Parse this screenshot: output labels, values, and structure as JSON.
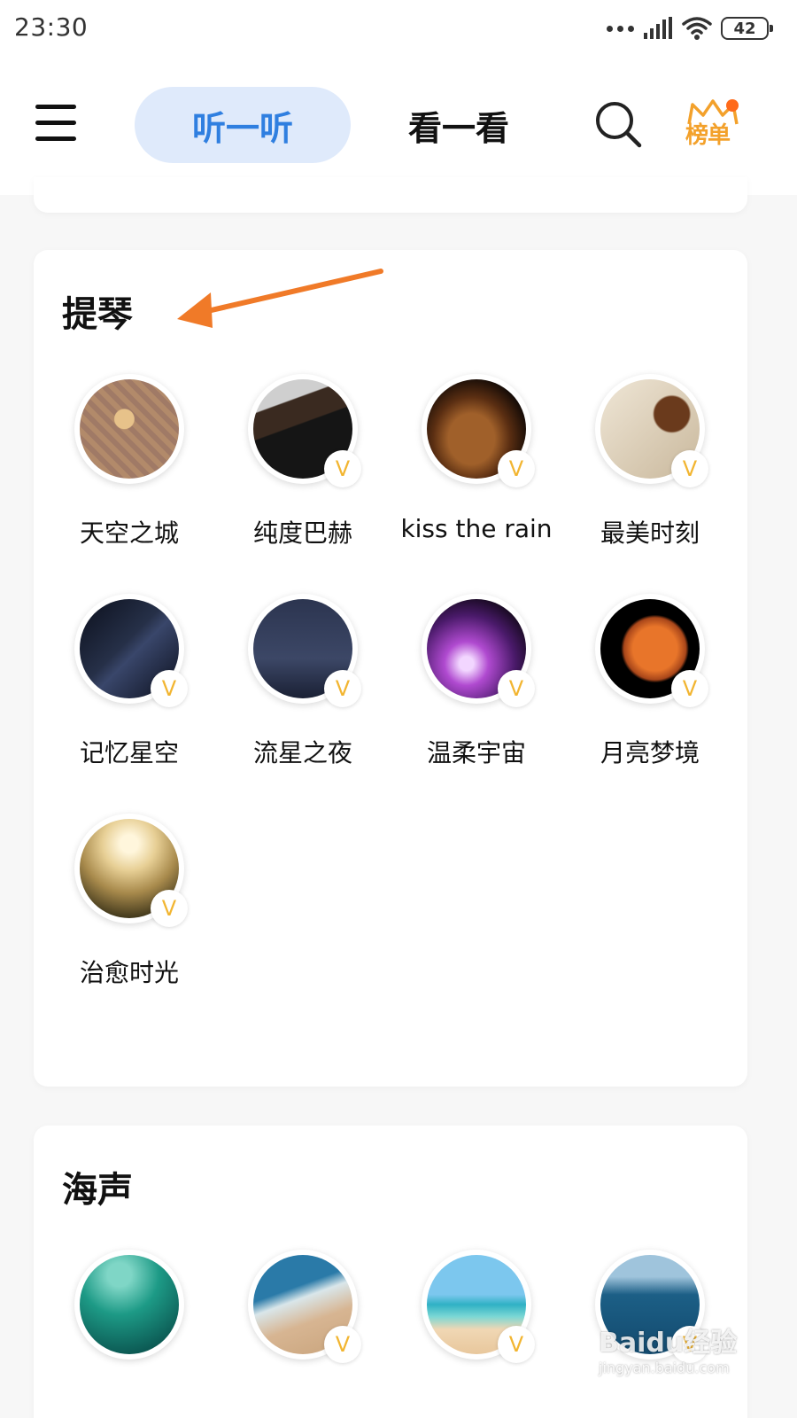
{
  "status_bar": {
    "time": "23:30",
    "battery": "42"
  },
  "header": {
    "menu_icon": "menu-icon",
    "tabs": [
      {
        "label": "听一听",
        "active": true
      },
      {
        "label": "看一看",
        "active": false
      }
    ],
    "search_icon": "search-icon",
    "rank_label": "榜单"
  },
  "sections": [
    {
      "title": "提琴",
      "items": [
        {
          "label": "天空之城",
          "vip": false
        },
        {
          "label": "纯度巴赫",
          "vip": true
        },
        {
          "label": "kiss the rain",
          "vip": true
        },
        {
          "label": "最美时刻",
          "vip": true
        },
        {
          "label": "记忆星空",
          "vip": true
        },
        {
          "label": "流星之夜",
          "vip": true
        },
        {
          "label": "温柔宇宙",
          "vip": true
        },
        {
          "label": "月亮梦境",
          "vip": true
        },
        {
          "label": "治愈时光",
          "vip": true
        }
      ]
    },
    {
      "title": "海声",
      "items": [
        {
          "vip": false
        },
        {
          "vip": true
        },
        {
          "vip": true
        },
        {
          "vip": true
        }
      ]
    }
  ],
  "vip_badge_text": "V",
  "watermark": {
    "main": "Baidu经验",
    "sub": "jingyan.baidu.com"
  },
  "colors": {
    "accent_blue": "#2f7fe0",
    "tab_bg": "#dfeafb",
    "rank_gold": "#f3a12b",
    "vip_gold": "#f2b531",
    "arrow_orange": "#f07a28"
  }
}
